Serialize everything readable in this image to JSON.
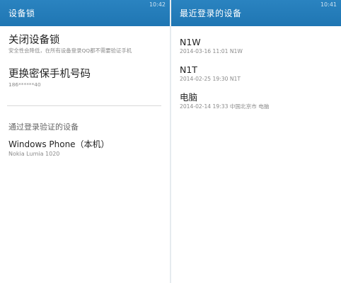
{
  "left": {
    "header": {
      "title": "设备锁",
      "time": "10:42"
    },
    "items": [
      {
        "title": "关闭设备锁",
        "subtitle": "安全性会降低，在所有设备登录QQ都不需要验证手机"
      },
      {
        "title": "更换密保手机号码",
        "subtitle": "186******40"
      }
    ],
    "section_label": "通过登录验证的设备",
    "devices": [
      {
        "title": "Windows Phone（本机）",
        "subtitle": "Nokia Lumia 1020"
      }
    ]
  },
  "right": {
    "header": {
      "title": "最近登录的设备",
      "time": "10:41"
    },
    "logins": [
      {
        "name": "N1W",
        "detail": "2014-03-16 11:01  N1W"
      },
      {
        "name": "N1T",
        "detail": "2014-02-25 19:30  N1T"
      },
      {
        "name": "电脑",
        "detail": "2014-02-14 19:33  中国北京市 电脑"
      }
    ]
  }
}
